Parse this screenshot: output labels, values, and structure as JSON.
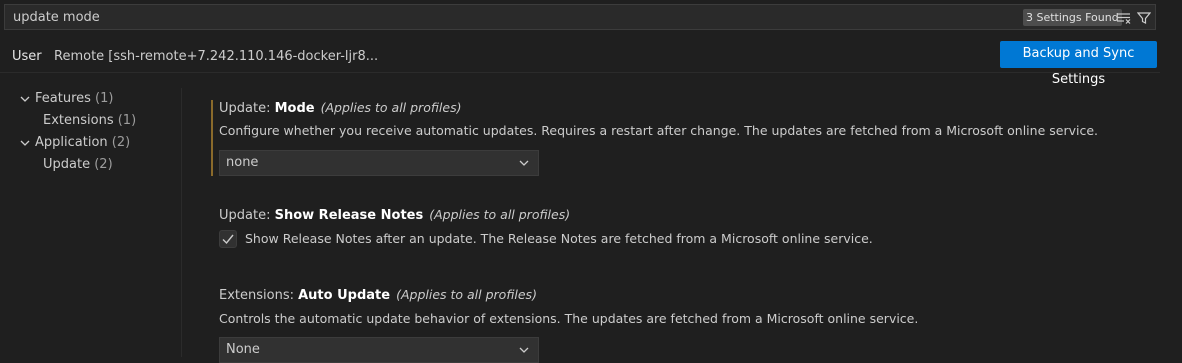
{
  "search": {
    "value": "update mode",
    "results_badge": "3 Settings Found"
  },
  "tabs": {
    "user": "User",
    "remote": "Remote [ssh-remote+7.242.110.146-docker-ljr8..."
  },
  "sync_button": "Backup and Sync Settings",
  "toc": [
    {
      "label": "Features",
      "count": "(1)",
      "expanded": true
    },
    {
      "label": "Extensions",
      "count": "(1)"
    },
    {
      "label": "Application",
      "count": "(2)",
      "expanded": true
    },
    {
      "label": "Update",
      "count": "(2)"
    }
  ],
  "settings": {
    "update_mode": {
      "category": "Update: ",
      "name": "Mode",
      "scope": "(Applies to all profiles)",
      "description": "Configure whether you receive automatic updates. Requires a restart after change. The updates are fetched from a Microsoft online service.",
      "value": "none",
      "modified": true
    },
    "release_notes": {
      "category": "Update: ",
      "name": "Show Release Notes",
      "scope": "(Applies to all profiles)",
      "description": "Show Release Notes after an update. The Release Notes are fetched from a Microsoft online service.",
      "checked": true
    },
    "auto_update": {
      "category": "Extensions: ",
      "name": "Auto Update",
      "scope": "(Applies to all profiles)",
      "description": "Controls the automatic update behavior of extensions. The updates are fetched from a Microsoft online service.",
      "value": "None"
    }
  },
  "colors": {
    "accent": "#0078d4",
    "modified_bar": "#8a6a2b",
    "background": "#1f1f1f"
  }
}
